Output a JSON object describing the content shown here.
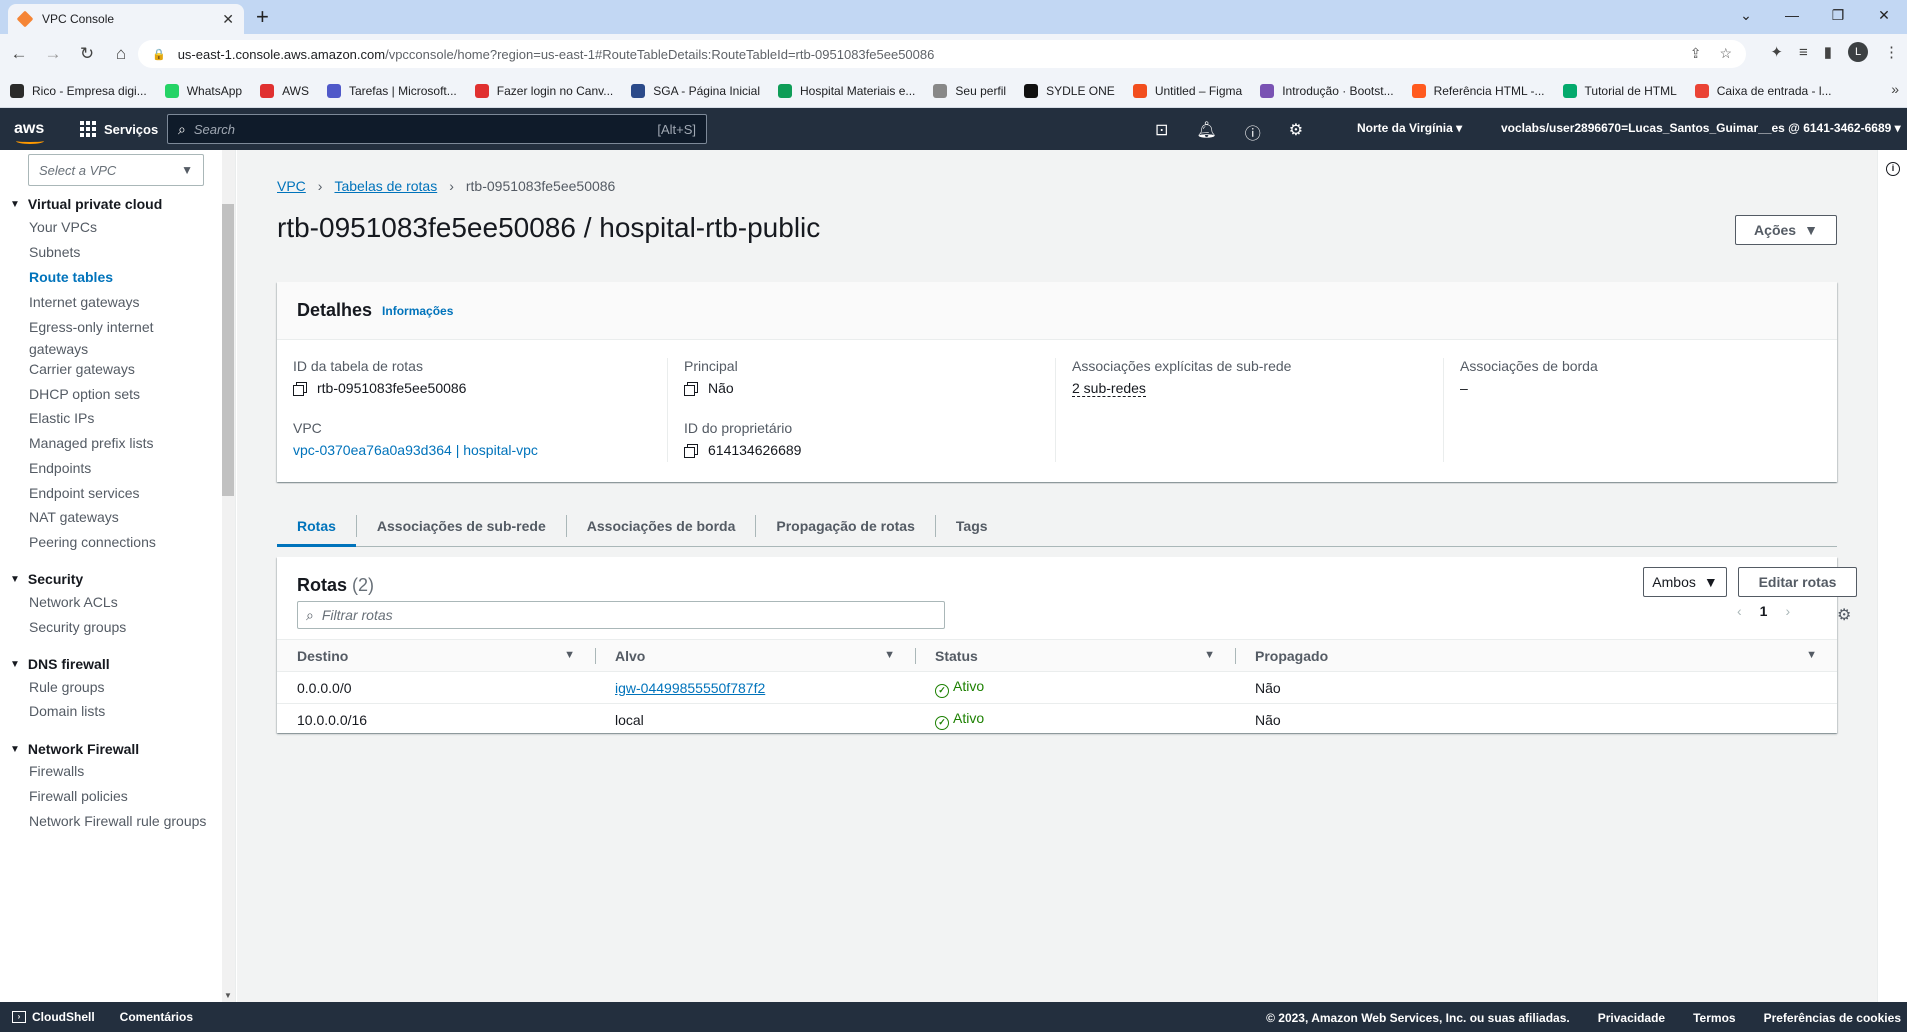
{
  "browser": {
    "tab_title": "VPC Console",
    "url_host": "us-east-1.console.aws.amazon.com",
    "url_path": "/vpcconsole/home?region=us-east-1#RouteTableDetails:RouteTableId=rtb-0951083fe5ee50086",
    "avatar_letter": "L",
    "bookmarks": [
      {
        "label": "Rico - Empresa digi...",
        "color": "#2b2b2b"
      },
      {
        "label": "WhatsApp",
        "color": "#25d366"
      },
      {
        "label": "AWS",
        "color": "#e03030"
      },
      {
        "label": "Tarefas | Microsoft...",
        "color": "#5059c9"
      },
      {
        "label": "Fazer login no Canv...",
        "color": "#e03030"
      },
      {
        "label": "SGA - Página Inicial",
        "color": "#2b4a8a"
      },
      {
        "label": "Hospital Materiais e...",
        "color": "#0f9d58"
      },
      {
        "label": "Seu perfil",
        "color": "#888888"
      },
      {
        "label": "SYDLE ONE",
        "color": "#111111"
      },
      {
        "label": "Untitled – Figma",
        "color": "#f24e1e"
      },
      {
        "label": "Introdução · Bootst...",
        "color": "#7952b3"
      },
      {
        "label": "Referência HTML -...",
        "color": "#ff5a1f"
      },
      {
        "label": "Tutorial de HTML",
        "color": "#04aa6d"
      },
      {
        "label": "Caixa de entrada - l...",
        "color": "#ea4335"
      }
    ]
  },
  "awsnav": {
    "services": "Serviços",
    "search_placeholder": "Search",
    "search_shortcut": "[Alt+S]",
    "region": "Norte da Virgínia",
    "account": "voclabs/user2896670=Lucas_Santos_Guimar__es @ 6141-3462-6689"
  },
  "sidebar": {
    "select_placeholder": "Select a VPC",
    "sections": [
      {
        "title": "Virtual private cloud",
        "items": [
          "Your VPCs",
          "Subnets",
          "Route tables",
          "Internet gateways",
          "Egress-only internet gateways",
          "Carrier gateways",
          "DHCP option sets",
          "Elastic IPs",
          "Managed prefix lists",
          "Endpoints",
          "Endpoint services",
          "NAT gateways",
          "Peering connections"
        ]
      },
      {
        "title": "Security",
        "items": [
          "Network ACLs",
          "Security groups"
        ]
      },
      {
        "title": "DNS firewall",
        "items": [
          "Rule groups",
          "Domain lists"
        ]
      },
      {
        "title": "Network Firewall",
        "items": [
          "Firewalls",
          "Firewall policies",
          "Network Firewall rule groups"
        ]
      }
    ],
    "active_item": "Route tables"
  },
  "breadcrumb": {
    "vpc": "VPC",
    "tables": "Tabelas de rotas",
    "current": "rtb-0951083fe5ee50086"
  },
  "page_title": "rtb-0951083fe5ee50086 / hospital-rtb-public",
  "actions_label": "Ações",
  "details": {
    "title": "Detalhes",
    "info_link": "Informações",
    "rt_id_label": "ID da tabela de rotas",
    "rt_id_value": "rtb-0951083fe5ee50086",
    "vpc_label": "VPC",
    "vpc_value": "vpc-0370ea76a0a93d364 | hospital-vpc",
    "main_label": "Principal",
    "main_value": "Não",
    "owner_label": "ID do proprietário",
    "owner_value": "614134626689",
    "explicit_label": "Associações explícitas de sub-rede",
    "explicit_value": "2 sub-redes",
    "edge_label": "Associações de borda",
    "edge_value": "–"
  },
  "tabs": [
    "Rotas",
    "Associações de sub-rede",
    "Associações de borda",
    "Propagação de rotas",
    "Tags"
  ],
  "routes": {
    "title": "Rotas",
    "count": "(2)",
    "filter_label": "Ambos",
    "edit_label": "Editar rotas",
    "filter_placeholder": "Filtrar rotas",
    "page": "1",
    "columns": [
      "Destino",
      "Alvo",
      "Status",
      "Propagado"
    ],
    "rows": [
      {
        "destino": "0.0.0.0/0",
        "alvo": "igw-04499855550f787f2",
        "status": "Ativo",
        "propagado": "Não"
      },
      {
        "destino": "10.0.0.0/16",
        "alvo": "local",
        "status": "Ativo",
        "propagado": "Não"
      }
    ]
  },
  "footer": {
    "cloudshell": "CloudShell",
    "comments": "Comentários",
    "copyright": "© 2023, Amazon Web Services, Inc. ou suas afiliadas.",
    "privacy": "Privacidade",
    "terms": "Termos",
    "cookies": "Preferências de cookies"
  }
}
